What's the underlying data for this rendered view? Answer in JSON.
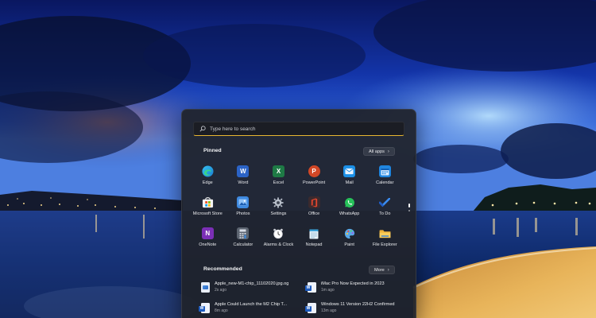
{
  "search": {
    "placeholder": "Type here to search",
    "icon": "search-icon"
  },
  "pinned": {
    "title": "Pinned",
    "all_apps_label": "All apps",
    "apps": [
      {
        "label": "Edge",
        "icon": "edge-icon",
        "color": "#1fa0d8"
      },
      {
        "label": "Word",
        "icon": "word-icon",
        "color": "#2b63c6"
      },
      {
        "label": "Excel",
        "icon": "excel-icon",
        "color": "#1e7a45"
      },
      {
        "label": "PowerPoint",
        "icon": "powerpoint-icon",
        "color": "#d24726"
      },
      {
        "label": "Mail",
        "icon": "mail-icon",
        "color": "#1b8fe6"
      },
      {
        "label": "Calendar",
        "icon": "calendar-icon",
        "color": "#1f86e0"
      },
      {
        "label": "Microsoft Store",
        "icon": "store-icon",
        "color": "#f4f4f4"
      },
      {
        "label": "Photos",
        "icon": "photos-icon",
        "color": "#3f8ae0"
      },
      {
        "label": "Settings",
        "icon": "settings-icon",
        "color": "#9aa3b0"
      },
      {
        "label": "Office",
        "icon": "office-icon",
        "color": "#c93b2a"
      },
      {
        "label": "WhatsApp",
        "icon": "whatsapp-icon",
        "color": "#27c25a"
      },
      {
        "label": "To Do",
        "icon": "todo-icon",
        "color": "#2f7ee8"
      },
      {
        "label": "OneNote",
        "icon": "onenote-icon",
        "color": "#7b2fb6"
      },
      {
        "label": "Calculator",
        "icon": "calculator-icon",
        "color": "#5c6470"
      },
      {
        "label": "Alarms & Clock",
        "icon": "alarm-clock-icon",
        "color": "#d9dbe0"
      },
      {
        "label": "Notepad",
        "icon": "notepad-icon",
        "color": "#3aa1d8"
      },
      {
        "label": "Paint",
        "icon": "paint-icon",
        "color": "#3d8fd8"
      },
      {
        "label": "File Explorer",
        "icon": "folder-icon",
        "color": "#f5c04a"
      }
    ]
  },
  "recommended": {
    "title": "Recommended",
    "more_label": "More",
    "items": [
      {
        "name": "Apple_new-M1-chip_11102020.jpg.og",
        "time": "2s ago",
        "icon": "image-file-icon"
      },
      {
        "name": "iMac Pro Now Expected in 2023",
        "time": "1m ago",
        "icon": "word-document-icon"
      },
      {
        "name": "Apple Could Launch the M2 Chip T...",
        "time": "8m ago",
        "icon": "word-document-icon"
      },
      {
        "name": "Windows 11 Version 22H2 Confirmed",
        "time": "13m ago",
        "icon": "word-document-icon"
      }
    ]
  }
}
